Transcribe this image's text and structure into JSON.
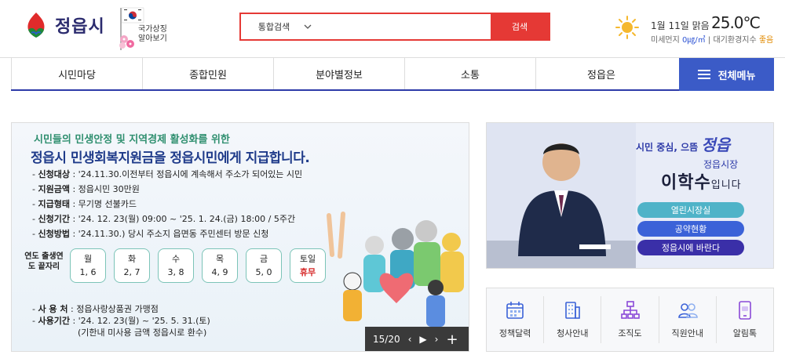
{
  "header": {
    "logo_text": "정읍시",
    "symbol_text_1": "국가상징",
    "symbol_text_2": "알아보기",
    "search": {
      "category": "통합검색",
      "placeholder": "",
      "button": "검색"
    },
    "weather": {
      "date": "1월 11일 맑음",
      "temp": "25.0℃",
      "dust_label": "미세먼지",
      "dust_value": "0㎍/㎥",
      "index_label": "대기환경지수",
      "index_value": "좋음",
      "icon": "sun-icon"
    }
  },
  "nav": {
    "items": [
      "시민마당",
      "종합민원",
      "분야별정보",
      "소통",
      "정읍은"
    ],
    "all_menu": "전체메뉴"
  },
  "banner": {
    "subtitle": "시민들의 민생안정 및 지역경제 활성화를 위한",
    "title": "정읍시 민생회복지원금을 정읍시민에게 지급합니다.",
    "rows": [
      {
        "label": "신청대상",
        "value": "'24.11.30.이전부터 정읍시에 계속해서 주소가 되어있는 시민"
      },
      {
        "label": "지원금액",
        "value": "정읍시민 30만원"
      },
      {
        "label": "지급형태",
        "value": "무기명 선불카드"
      },
      {
        "label": "신청기간",
        "value": "'24. 12. 23(월) 09:00 ~ '25. 1. 24.(금) 18:00 / 5주간"
      },
      {
        "label": "신청방법",
        "value": "'24.11.30.) 당시 주소지 읍면동 주민센터 방문 신청"
      }
    ],
    "days_label": "연도 출생연도 끝자리",
    "days": [
      {
        "day": "월",
        "digits": "1, 6"
      },
      {
        "day": "화",
        "digits": "2, 7"
      },
      {
        "day": "수",
        "digits": "3, 8"
      },
      {
        "day": "목",
        "digits": "4, 9"
      },
      {
        "day": "금",
        "digits": "5, 0"
      },
      {
        "day": "토일",
        "digits": "휴무"
      }
    ],
    "foot": [
      {
        "label": "사 용 처",
        "value": "정읍사랑상품권 가맹점"
      },
      {
        "label": "사용기간",
        "value": "'24. 12. 23(월) ~ '25. 5. 31.(토)"
      }
    ],
    "foot_note": "(기한내 미사용 금액 정읍시로 환수)",
    "slider": {
      "counter": "15/20",
      "prev": "‹",
      "play": "▶",
      "next": "›",
      "more": "+"
    }
  },
  "mayor": {
    "slogan": "시민 중심, 으뜸",
    "slogan_big": "정읍",
    "role": "정읍시장",
    "name": "이학수",
    "name_suffix": "입니다",
    "buttons": [
      "열린시장실",
      "공약현황",
      "정읍시에 바란다"
    ]
  },
  "quick_links": [
    {
      "label": "정책달력",
      "icon": "calendar-icon",
      "color": "#3b62d8"
    },
    {
      "label": "청사안내",
      "icon": "building-icon",
      "color": "#3b62d8"
    },
    {
      "label": "조직도",
      "icon": "org-chart-icon",
      "color": "#8a4ad8"
    },
    {
      "label": "직원안내",
      "icon": "staff-icon",
      "color": "#3b62d8"
    },
    {
      "label": "알림톡",
      "icon": "message-icon",
      "color": "#8a4ad8"
    }
  ]
}
